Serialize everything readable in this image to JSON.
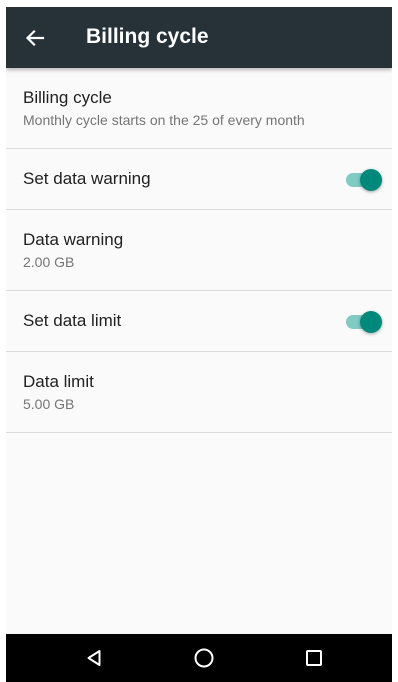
{
  "app_bar": {
    "title": "Billing cycle",
    "back_icon": "arrow-back-icon"
  },
  "preferences": [
    {
      "title": "Billing cycle",
      "summary": "Monthly cycle starts on the 25 of every month"
    },
    {
      "title": "Set data warning",
      "switch_on": true
    },
    {
      "title": "Data warning",
      "summary": "2.00 GB"
    },
    {
      "title": "Set data limit",
      "switch_on": true
    },
    {
      "title": "Data limit",
      "summary": "5.00 GB"
    }
  ],
  "nav_bar": {
    "back_icon": "nav-back-icon",
    "home_icon": "nav-home-icon",
    "recents_icon": "nav-recents-icon"
  },
  "colors": {
    "app_bar": "#263238",
    "accent": "#00897b",
    "accent_track": "#80cbc4",
    "background": "#fafafa",
    "nav_bar": "#000000"
  }
}
